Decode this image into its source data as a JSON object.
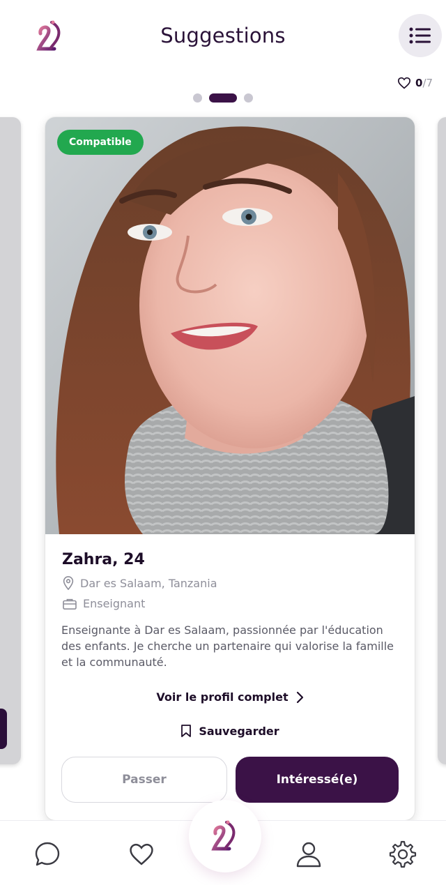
{
  "header": {
    "title": "Suggestions",
    "likes_count": "0",
    "likes_total": "/7"
  },
  "pager": {
    "count": 3,
    "active_index": 1
  },
  "profile": {
    "badge": "Compatible",
    "name_age": "Zahra, 24",
    "location": "Dar es Salaam, Tanzania",
    "job": "Enseignant",
    "bio": "Enseignante à Dar es Salaam, passionnée par l'éducation des enfants. Je cherche un partenaire qui valorise la famille et la communauté.",
    "view_full_label": "Voir le profil complet",
    "save_label": "Sauvegarder",
    "pass_label": "Passer",
    "interested_label": "Intéressé(e)"
  },
  "colors": {
    "primary": "#3b1247",
    "compatible_badge": "#22a84f",
    "muted_text": "#8e8e99"
  },
  "nav": {
    "items": [
      "chat-icon",
      "heart-icon",
      "app-logo",
      "profile-icon",
      "settings-icon"
    ]
  }
}
